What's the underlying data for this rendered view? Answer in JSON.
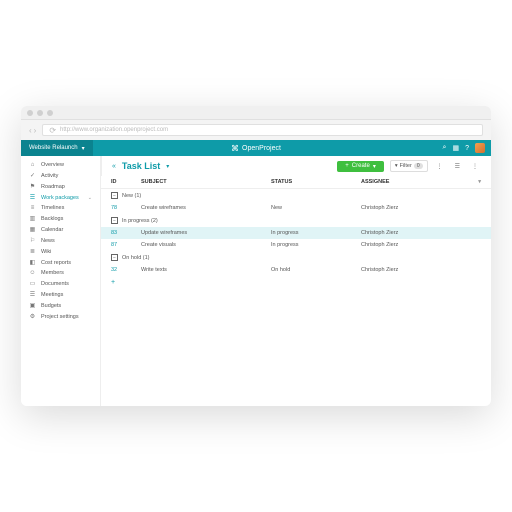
{
  "url": "http://www.organization.openproject.com",
  "brand": "OpenProject",
  "project_selector": "Website Relaunch",
  "top_right": {
    "search_icon": "⌕",
    "help_icon": "?",
    "grid_icon": "▦"
  },
  "sidebar": [
    {
      "icon": "⌂",
      "label": "Overview"
    },
    {
      "icon": "✓",
      "label": "Activity"
    },
    {
      "icon": "⚑",
      "label": "Roadmap"
    },
    {
      "icon": "☰",
      "label": "Work packages",
      "caret": "⌄",
      "active": true
    },
    {
      "icon": "≡",
      "label": "Timelines"
    },
    {
      "icon": "▥",
      "label": "Backlogs"
    },
    {
      "icon": "▦",
      "label": "Calendar"
    },
    {
      "icon": "⚐",
      "label": "News"
    },
    {
      "icon": "≣",
      "label": "Wiki"
    },
    {
      "icon": "◧",
      "label": "Cost reports"
    },
    {
      "icon": "☺",
      "label": "Members"
    },
    {
      "icon": "▭",
      "label": "Documents"
    },
    {
      "icon": "☰",
      "label": "Meetings"
    },
    {
      "icon": "▣",
      "label": "Budgets"
    },
    {
      "icon": "⚙",
      "label": "Project settings"
    }
  ],
  "page_title": "Task List",
  "toolbar": {
    "create_label": "Create",
    "filter_label": "Filter",
    "filter_count": "0"
  },
  "columns": {
    "id": "ID",
    "subject": "SUBJECT",
    "status": "STATUS",
    "assignee": "ASSIGNEE"
  },
  "groups": [
    {
      "label": "New (1)",
      "rows": [
        {
          "id": "78",
          "subject": "Create wireframes",
          "status": "New",
          "assignee": "Christoph Zierz"
        }
      ]
    },
    {
      "label": "In progress (2)",
      "rows": [
        {
          "id": "83",
          "subject": "Update wireframes",
          "status": "In progress",
          "assignee": "Christoph Zierz",
          "hl": true
        },
        {
          "id": "87",
          "subject": "Create visuals",
          "status": "In progress",
          "assignee": "Christoph Zierz"
        }
      ]
    },
    {
      "label": "On hold (1)",
      "rows": [
        {
          "id": "32",
          "subject": "Write texts",
          "status": "On hold",
          "assignee": "Christoph Zierz"
        }
      ]
    }
  ],
  "inline_add": "+"
}
